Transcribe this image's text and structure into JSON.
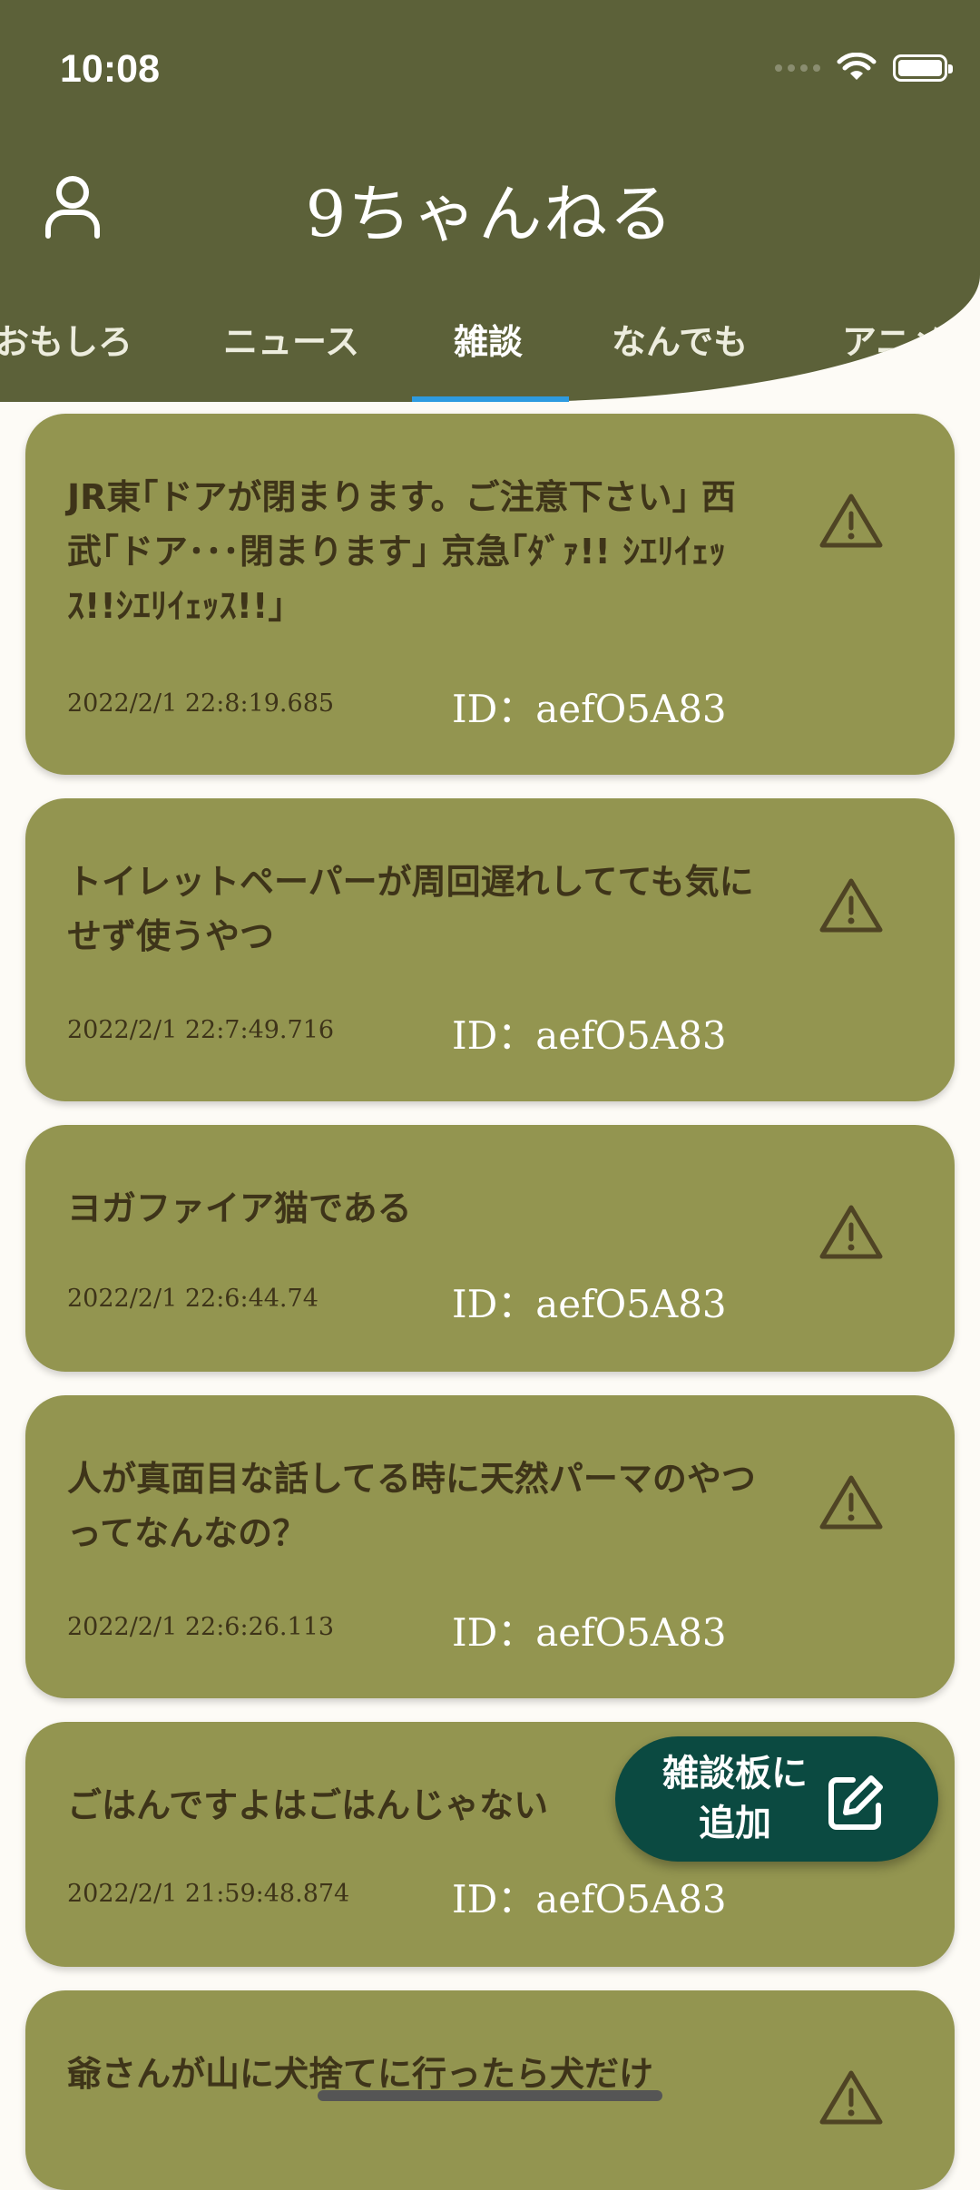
{
  "status_bar": {
    "time": "10:08"
  },
  "header": {
    "title": "9ちゃんねる",
    "tabs": [
      "おもしろ",
      "ニュース",
      "雑談",
      "なんでも",
      "アニメ・"
    ],
    "active_tab": "雑談"
  },
  "posts": [
    {
      "title": "JR東｢ドアが閉まります。ご注意下さい｣ 西武｢ドア･･･閉まります｣ 京急｢ﾀﾞｧ!! ｼｴﾘｲｪｯｽ!!ｼｴﾘｲｪｯｽ!!｣",
      "date": "2022/2/1 22:8:19.685",
      "id": "ID：aefO5A83"
    },
    {
      "title": "トイレットペーパーが周回遅れしてても気にせず使うやつ",
      "date": "2022/2/1 22:7:49.716",
      "id": "ID：aefO5A83"
    },
    {
      "title": "ヨガファイア猫である",
      "date": "2022/2/1 22:6:44.74",
      "id": "ID：aefO5A83"
    },
    {
      "title": "人が真面目な話してる時に天然パーマのやつってなんなの？",
      "date": "2022/2/1 22:6:26.113",
      "id": "ID：aefO5A83"
    },
    {
      "title": "ごはんですよはごはんじゃない",
      "date": "2022/2/1 21:59:48.874",
      "id": "ID：aefO5A83"
    },
    {
      "title": "爺さんが山に犬捨てに行ったら犬だけ",
      "date": "",
      "id": ""
    }
  ],
  "fab": {
    "label": "雑談板に追加"
  },
  "colors": {
    "header_bg": "#5c6139",
    "card_bg": "#939550",
    "fab_bg": "#0b4a41",
    "tab_indicator": "#2e9be0",
    "page_bg": "#fdfbf6"
  },
  "icons": {
    "profile": "person-outline-icon",
    "warning": "warning-triangle-icon",
    "fab": "edit-square-icon"
  }
}
